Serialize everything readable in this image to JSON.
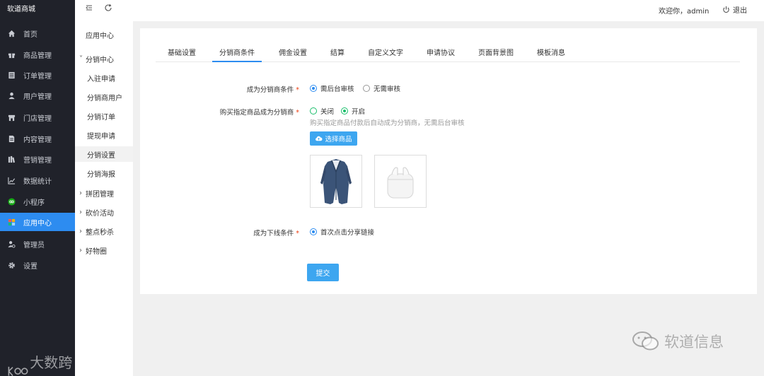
{
  "brand": "软道商城",
  "sidebar": {
    "items": [
      {
        "label": "首页",
        "icon": "home-icon"
      },
      {
        "label": "商品管理",
        "icon": "gift-icon"
      },
      {
        "label": "订单管理",
        "icon": "list-icon"
      },
      {
        "label": "用户管理",
        "icon": "user-icon"
      },
      {
        "label": "门店管理",
        "icon": "store-icon"
      },
      {
        "label": "内容管理",
        "icon": "document-icon"
      },
      {
        "label": "营销管理",
        "icon": "books-icon"
      },
      {
        "label": "数据统计",
        "icon": "chart-icon"
      },
      {
        "label": "小程序",
        "icon": "miniprogram-icon"
      },
      {
        "label": "应用中心",
        "icon": "apps-icon",
        "active": true
      },
      {
        "label": "管理员",
        "icon": "admin-icon"
      },
      {
        "label": "设置",
        "icon": "gear-icon"
      }
    ],
    "active_color": "#2d8cf0"
  },
  "subnav": {
    "title": "应用中心",
    "group": "分销中心",
    "children": [
      "入驻申请",
      "分销商用户",
      "分销订单",
      "提现申请",
      "分销设置",
      "分销海报"
    ],
    "selected": "分销设置",
    "more": [
      "拼团管理",
      "砍价活动",
      "整点秒杀",
      "好物圈"
    ]
  },
  "topbar": {
    "welcome": "欢迎你，admin",
    "logout": "退出"
  },
  "tabs": [
    "基础设置",
    "分销商条件",
    "佣金设置",
    "结算",
    "自定义文字",
    "申请协议",
    "页面背景图",
    "模板消息"
  ],
  "active_tab": "分销商条件",
  "form": {
    "condition_label": "成为分销商条件",
    "condition_options": [
      "需后台审核",
      "无需审核"
    ],
    "buy_label": "购买指定商品成为分销商",
    "buy_options": [
      "关闭",
      "开启"
    ],
    "buy_hint": "购买指定商品付款后自动成为分销商，无需后台审核",
    "select_goods_label": "选择商品",
    "goods": [
      "coat-product-image",
      "earbuds-product-image"
    ],
    "downline_label": "成为下线条件",
    "downline_option": "首次点击分享链接",
    "submit_label": "提交"
  },
  "watermarks": {
    "left": "大数跨境",
    "right": "软道信息"
  },
  "colors": {
    "primary": "#2d8cf0",
    "button": "#3da6f0",
    "required": "#ed4014",
    "green": "#19be6b",
    "sidebar_bg": "#20222a"
  }
}
